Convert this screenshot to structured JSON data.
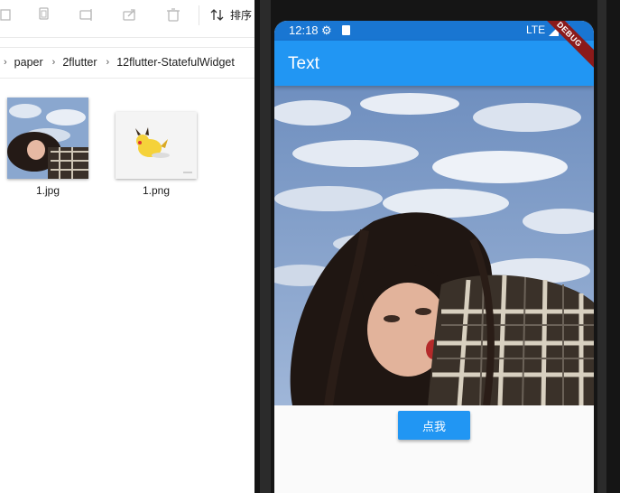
{
  "explorer": {
    "sort_label": "排序",
    "breadcrumb": [
      "paper",
      "2flutter",
      "12flutter-StatefulWidget"
    ],
    "files": [
      {
        "name": "1.jpg"
      },
      {
        "name": "1.png"
      }
    ]
  },
  "phone": {
    "status": {
      "time": "12:18",
      "network": "LTE"
    },
    "appbar_title": "Text",
    "debug_banner": "DEBUG",
    "button_label": "点我",
    "colors": {
      "appbar": "#2196f3",
      "statusbar": "#1976d2",
      "button": "#2196f3"
    }
  }
}
